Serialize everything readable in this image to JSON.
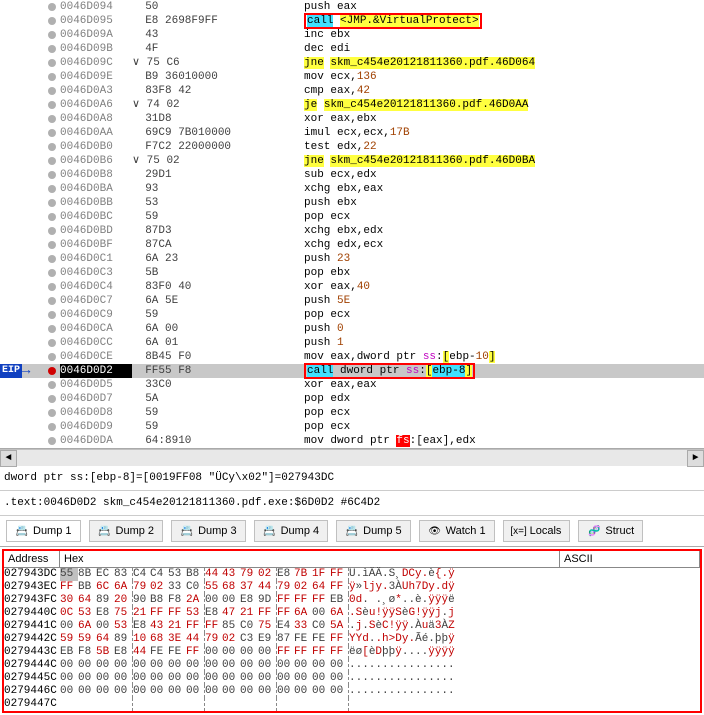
{
  "disasm": [
    {
      "addr": "0046D094",
      "bytes": "50",
      "i": "push eax"
    },
    {
      "addr": "0046D095",
      "bytes": "E8 2698F9FF",
      "i": "call <JMP.&VirtualProtect>",
      "callvp": true
    },
    {
      "addr": "0046D09A",
      "bytes": "43",
      "i": "inc ebx"
    },
    {
      "addr": "0046D09B",
      "bytes": "4F",
      "i": "dec edi"
    },
    {
      "addr": "0046D09C",
      "bytes": "75 C6",
      "pre": "∨",
      "i": "jne skm_c454e20121811360.pdf.46D064",
      "jcc": true
    },
    {
      "addr": "0046D09E",
      "bytes": "B9 36010000",
      "i": "mov ecx,136"
    },
    {
      "addr": "0046D0A3",
      "bytes": "83F8 42",
      "i": "cmp eax,42"
    },
    {
      "addr": "0046D0A6",
      "bytes": "74 02",
      "pre": "∨",
      "i": "je skm_c454e20121811360.pdf.46D0AA",
      "jcc": true
    },
    {
      "addr": "0046D0A8",
      "bytes": "31D8",
      "i": "xor eax,ebx"
    },
    {
      "addr": "0046D0AA",
      "bytes": "69C9 7B010000",
      "i": "imul ecx,ecx,17B"
    },
    {
      "addr": "0046D0B0",
      "bytes": "F7C2 22000000",
      "i": "test edx,22"
    },
    {
      "addr": "0046D0B6",
      "bytes": "75 02",
      "pre": "∨",
      "i": "jne skm_c454e20121811360.pdf.46D0BA",
      "jcc": true
    },
    {
      "addr": "0046D0B8",
      "bytes": "29D1",
      "i": "sub ecx,edx"
    },
    {
      "addr": "0046D0BA",
      "bytes": "93",
      "i": "xchg ebx,eax"
    },
    {
      "addr": "0046D0BB",
      "bytes": "53",
      "i": "push ebx"
    },
    {
      "addr": "0046D0BC",
      "bytes": "59",
      "i": "pop ecx"
    },
    {
      "addr": "0046D0BD",
      "bytes": "87D3",
      "i": "xchg ebx,edx"
    },
    {
      "addr": "0046D0BF",
      "bytes": "87CA",
      "i": "xchg edx,ecx"
    },
    {
      "addr": "0046D0C1",
      "bytes": "6A 23",
      "i": "push 23"
    },
    {
      "addr": "0046D0C3",
      "bytes": "5B",
      "i": "pop ebx"
    },
    {
      "addr": "0046D0C4",
      "bytes": "83F0 40",
      "i": "xor eax,40"
    },
    {
      "addr": "0046D0C7",
      "bytes": "6A 5E",
      "i": "push 5E"
    },
    {
      "addr": "0046D0C9",
      "bytes": "59",
      "i": "pop ecx"
    },
    {
      "addr": "0046D0CA",
      "bytes": "6A 00",
      "i": "push 0"
    },
    {
      "addr": "0046D0CC",
      "bytes": "6A 01",
      "i": "push 1"
    },
    {
      "addr": "0046D0CE",
      "bytes": "8B45 F0",
      "i": "mov eax,dword ptr ss:[ebp-10]",
      "mem": true
    },
    {
      "addr": "0046D0D2",
      "bytes": "FF55 F8",
      "i": "call dword ptr ss:[ebp-8]",
      "eip": true,
      "calldp": true
    },
    {
      "addr": "0046D0D5",
      "bytes": "33C0",
      "i": "xor eax,eax"
    },
    {
      "addr": "0046D0D7",
      "bytes": "5A",
      "i": "pop edx"
    },
    {
      "addr": "0046D0D8",
      "bytes": "59",
      "i": "pop ecx"
    },
    {
      "addr": "0046D0D9",
      "bytes": "59",
      "i": "pop ecx"
    },
    {
      "addr": "0046D0DA",
      "bytes": "64:8910",
      "i": "mov dword ptr fs:[eax],edx",
      "fs": true
    }
  ],
  "info1": "dword ptr ss:[ebp-8]=[0019FF08 \"ÜCy\\x02\"]=027943DC",
  "info2": ".text:0046D0D2 skm_c454e20121811360.pdf.exe:$6D0D2 #6C4D2",
  "tabs": [
    {
      "label": "Dump 1",
      "icon": "📇"
    },
    {
      "label": "Dump 2",
      "icon": "📇"
    },
    {
      "label": "Dump 3",
      "icon": "📇"
    },
    {
      "label": "Dump 4",
      "icon": "📇"
    },
    {
      "label": "Dump 5",
      "icon": "📇"
    },
    {
      "label": "Watch 1",
      "icon": "👁"
    },
    {
      "label": "Locals",
      "icon": "[x=]"
    },
    {
      "label": "Struct",
      "icon": "🧬"
    }
  ],
  "hex_header": {
    "addr": "Address",
    "hex": "Hex",
    "asc": "ASCII"
  },
  "hex": [
    {
      "a": "027943DC",
      "b": [
        "55",
        "8B",
        "EC",
        "83",
        "C4",
        "C4",
        "53",
        "B8",
        "44",
        "43",
        "79",
        "02",
        "E8",
        "7B",
        "1F",
        "FF"
      ],
      "r": [
        0,
        0,
        0,
        0,
        0,
        0,
        0,
        0,
        1,
        1,
        1,
        1,
        0,
        1,
        1,
        1
      ],
      "t": "U.ìÄÄ.S¸DCy.è{.ÿ",
      "tr": "........rrrr.rrr"
    },
    {
      "a": "027943EC",
      "b": [
        "FF",
        "BB",
        "6C",
        "6A",
        "79",
        "02",
        "33",
        "C0",
        "55",
        "68",
        "37",
        "44",
        "79",
        "02",
        "64",
        "FF"
      ],
      "r": [
        1,
        0,
        1,
        1,
        1,
        1,
        0,
        0,
        1,
        1,
        1,
        1,
        1,
        1,
        1,
        1
      ],
      "t": "ÿ»ljy.3ÀUh7Dy.dÿ",
      "tr": "r.rrrr..rrrrrrrr"
    },
    {
      "a": "027943FC",
      "b": [
        "30",
        "64",
        "89",
        "20",
        "90",
        "B8",
        "F8",
        "2A",
        "00",
        "00",
        "E8",
        "9D",
        "FF",
        "FF",
        "FF",
        "EB"
      ],
      "r": [
        1,
        1,
        0,
        1,
        0,
        0,
        0,
        1,
        0,
        0,
        0,
        0,
        1,
        1,
        1,
        0
      ],
      "t": "0d. .¸ø*..è.ÿÿÿë",
      "tr": "rr.r...r....rrr."
    },
    {
      "a": "0279440C",
      "b": [
        "0C",
        "53",
        "E8",
        "75",
        "21",
        "FF",
        "FF",
        "53",
        "E8",
        "47",
        "21",
        "FF",
        "FF",
        "6A",
        "00",
        "6A"
      ],
      "r": [
        1,
        1,
        0,
        1,
        1,
        1,
        1,
        1,
        0,
        1,
        1,
        1,
        1,
        1,
        0,
        1
      ],
      "t": ".Sèu!ÿÿSèG!ÿÿj.j",
      "tr": "rr.rrrrr.rrrrr.r"
    },
    {
      "a": "0279441C",
      "b": [
        "00",
        "6A",
        "00",
        "53",
        "E8",
        "43",
        "21",
        "FF",
        "FF",
        "85",
        "C0",
        "75",
        "E4",
        "33",
        "C0",
        "5A"
      ],
      "r": [
        0,
        1,
        0,
        1,
        0,
        1,
        1,
        1,
        1,
        0,
        0,
        1,
        0,
        1,
        0,
        1
      ],
      "t": ".j.SèC!ÿÿ.Àuä3ÀZ",
      "tr": ".r.r.rrrr..r.r.r"
    },
    {
      "a": "0279442C",
      "b": [
        "59",
        "59",
        "64",
        "89",
        "10",
        "68",
        "3E",
        "44",
        "79",
        "02",
        "C3",
        "E9",
        "87",
        "FE",
        "FE",
        "FF"
      ],
      "r": [
        1,
        1,
        1,
        0,
        1,
        1,
        1,
        1,
        1,
        1,
        0,
        0,
        0,
        0,
        0,
        1
      ],
      "t": "YYd..h>Dy.Ãé.þþÿ",
      "tr": "rrr.rrrrrr.....r"
    },
    {
      "a": "0279443C",
      "b": [
        "EB",
        "F8",
        "5B",
        "E8",
        "44",
        "FE",
        "FE",
        "FF",
        "00",
        "00",
        "00",
        "00",
        "FF",
        "FF",
        "FF",
        "FF"
      ],
      "r": [
        0,
        0,
        1,
        0,
        1,
        0,
        0,
        1,
        0,
        0,
        0,
        0,
        1,
        1,
        1,
        1
      ],
      "t": "ëø[èDþþÿ....ÿÿÿÿ",
      "tr": "..r.r..r....rrrr"
    },
    {
      "a": "0279444C",
      "b": [
        "00",
        "00",
        "00",
        "00",
        "00",
        "00",
        "00",
        "00",
        "00",
        "00",
        "00",
        "00",
        "00",
        "00",
        "00",
        "00"
      ],
      "r": [
        0,
        0,
        0,
        0,
        0,
        0,
        0,
        0,
        0,
        0,
        0,
        0,
        0,
        0,
        0,
        0
      ],
      "t": "................",
      "tr": "................"
    },
    {
      "a": "0279445C",
      "b": [
        "00",
        "00",
        "00",
        "00",
        "00",
        "00",
        "00",
        "00",
        "00",
        "00",
        "00",
        "00",
        "00",
        "00",
        "00",
        "00"
      ],
      "r": [
        0,
        0,
        0,
        0,
        0,
        0,
        0,
        0,
        0,
        0,
        0,
        0,
        0,
        0,
        0,
        0
      ],
      "t": "................",
      "tr": "................"
    },
    {
      "a": "0279446C",
      "b": [
        "00",
        "00",
        "00",
        "00",
        "00",
        "00",
        "00",
        "00",
        "00",
        "00",
        "00",
        "00",
        "00",
        "00",
        "00",
        "00"
      ],
      "r": [
        0,
        0,
        0,
        0,
        0,
        0,
        0,
        0,
        0,
        0,
        0,
        0,
        0,
        0,
        0,
        0
      ],
      "t": "................",
      "tr": "................"
    },
    {
      "a": "0279447C",
      "b": [
        "  ",
        "  ",
        "  ",
        "  ",
        "  ",
        "  ",
        "  ",
        "  ",
        "  ",
        "  ",
        "  ",
        "  ",
        "  ",
        "  ",
        "  ",
        "  "
      ],
      "r": [
        0,
        0,
        0,
        0,
        0,
        0,
        0,
        0,
        0,
        0,
        0,
        0,
        0,
        0,
        0,
        0
      ],
      "t": "",
      "tr": ""
    }
  ]
}
